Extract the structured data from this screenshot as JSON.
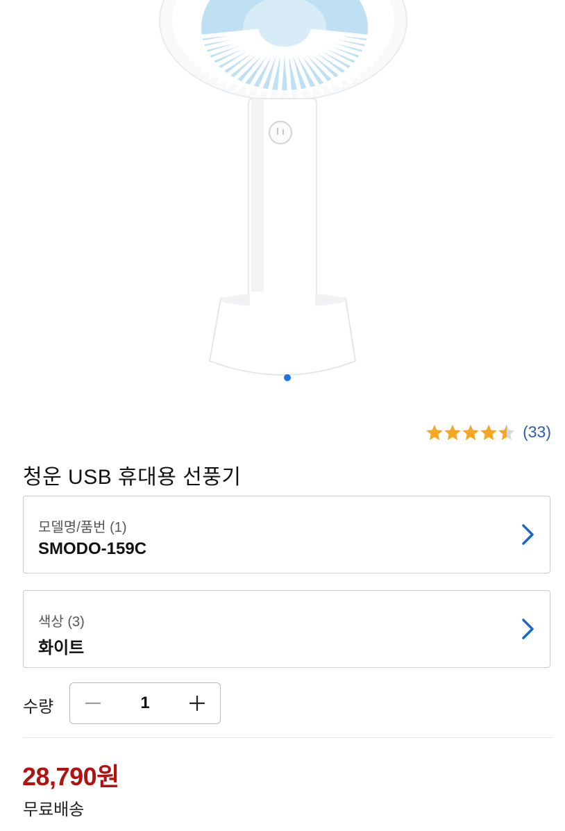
{
  "product": {
    "image_alt": "청운 USB 휴대용 선풍기",
    "carousel_active_index": 0,
    "carousel_count": 1,
    "rating": 4.5,
    "rating_max": 5,
    "review_count": "(33)",
    "title": "청운 USB 휴대용 선풍기"
  },
  "options": [
    {
      "label": "모델명/품번 (1)",
      "value": "SMODO-159C"
    },
    {
      "label": "색상 (3)",
      "value": "화이트"
    }
  ],
  "quantity": {
    "label": "수량",
    "value": "1"
  },
  "price": {
    "amount": "28,790원",
    "shipping": "무료배송"
  },
  "colors": {
    "price": "#b1120f",
    "accent": "#1a73e8",
    "star": "#f5a623",
    "link": "#2a5db0"
  }
}
